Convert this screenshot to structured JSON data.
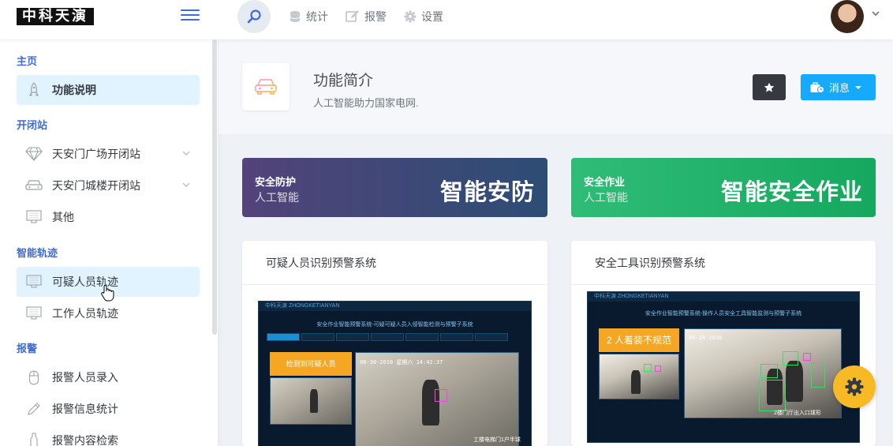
{
  "header": {
    "logo_text": "中科天演",
    "nav": [
      {
        "label": "统计",
        "icon": "database-icon"
      },
      {
        "label": "报警",
        "icon": "edit-icon"
      },
      {
        "label": "设置",
        "icon": "gear-icon"
      }
    ]
  },
  "sidebar": {
    "sections": [
      {
        "heading": "主页",
        "items": [
          {
            "label": "功能说明",
            "icon": "rocket-icon",
            "active": true
          }
        ]
      },
      {
        "heading": "开闭站",
        "items": [
          {
            "label": "天安门广场开闭站",
            "icon": "diamond-icon",
            "expandable": true
          },
          {
            "label": "天安门城楼开闭站",
            "icon": "car-icon",
            "expandable": true
          },
          {
            "label": "其他",
            "icon": "monitor-icon"
          }
        ]
      },
      {
        "heading": "智能轨迹",
        "items": [
          {
            "label": "可疑人员轨迹",
            "icon": "monitor-icon",
            "active": true
          },
          {
            "label": "工作人员轨迹",
            "icon": "monitor-icon"
          }
        ]
      },
      {
        "heading": "报警",
        "items": [
          {
            "label": "报警人员录入",
            "icon": "mouse-icon"
          },
          {
            "label": "报警信息统计",
            "icon": "pen-icon"
          },
          {
            "label": "报警内容检索",
            "icon": "bottle-icon"
          }
        ]
      }
    ]
  },
  "page": {
    "title": "功能简介",
    "subtitle": "人工智能助力国家电网.",
    "msg_button": "消息"
  },
  "banners": [
    {
      "title": "安全防护",
      "sub": "人工智能",
      "big": "智能安防"
    },
    {
      "title": "安全作业",
      "sub": "人工智能",
      "big": "智能安全作业"
    }
  ],
  "cards": [
    {
      "title": "可疑人员识别预警系统",
      "screen": {
        "brand": "中科天演 ZHONGKETIANYAN",
        "system_title": "安全作业智能预警系统-可疑可疑人员入侵智能检测与预警子系统",
        "alert": "检测到可疑人员",
        "timestamp": "06-30-2018 星期六 14:42:37",
        "caption": "工楼电梯门1户半球"
      }
    },
    {
      "title": "安全工具识别预警系统",
      "screen": {
        "brand": "中科天演 ZHONGKETIANYAN",
        "system_title": "安全作业智能预警系统-操作人员安全工具智能监测与预警子系统",
        "alert": "2 人着装不规范",
        "timestamp": "06-28-2018",
        "caption": "2楼门厅出入口球形"
      }
    }
  ],
  "colors": {
    "primary": "#3f6ad8",
    "info": "#16aaff",
    "success": "#16a85e",
    "warning": "#f7b924",
    "dark": "#343a40"
  }
}
